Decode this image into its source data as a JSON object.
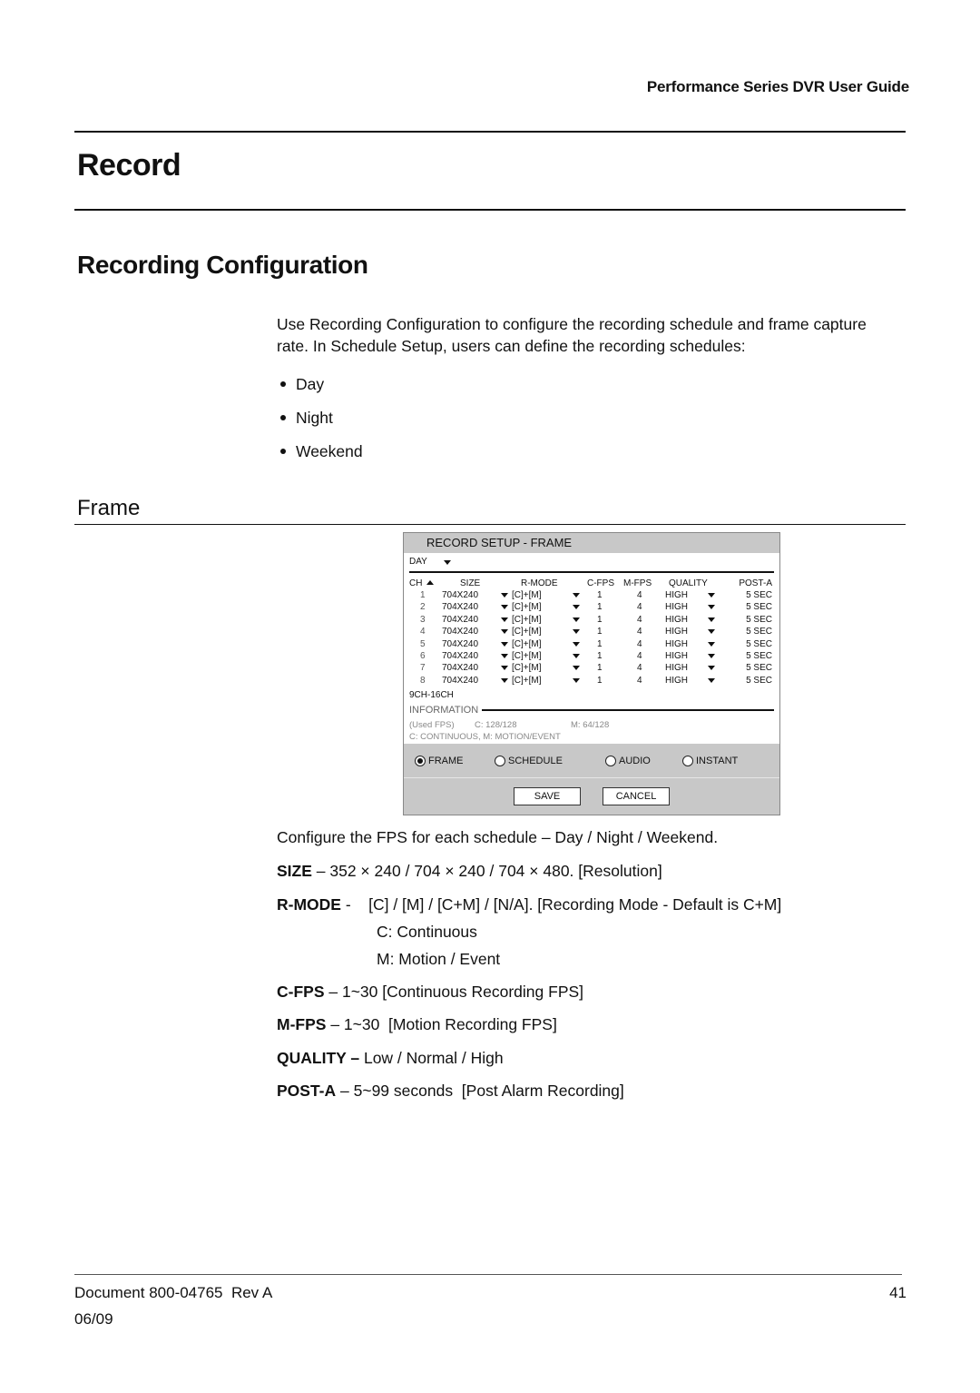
{
  "header": {
    "guide_title": "Performance Series DVR User Guide"
  },
  "chapter": {
    "title": "Record"
  },
  "section": {
    "title": "Recording Configuration",
    "intro": "Use Recording Configuration to configure the recording schedule and frame capture rate. In Schedule Setup, users can define the recording schedules:",
    "schedules": [
      "Day",
      "Night",
      "Weekend"
    ]
  },
  "subsection": {
    "title": "Frame"
  },
  "dvr_screen": {
    "title": "RECORD SETUP - FRAME",
    "schedule_select": "DAY",
    "columns": {
      "ch": "CH",
      "size": "SIZE",
      "rmode": "R-MODE",
      "cfps": "C-FPS",
      "mfps": "M-FPS",
      "quality": "QUALITY",
      "posta": "POST-A"
    },
    "rows": [
      {
        "ch": "1",
        "size": "704X240",
        "rmode": "[C]+[M]",
        "cfps": "1",
        "mfps": "4",
        "quality": "HIGH",
        "posta": "5 SEC"
      },
      {
        "ch": "2",
        "size": "704X240",
        "rmode": "[C]+[M]",
        "cfps": "1",
        "mfps": "4",
        "quality": "HIGH",
        "posta": "5 SEC"
      },
      {
        "ch": "3",
        "size": "704X240",
        "rmode": "[C]+[M]",
        "cfps": "1",
        "mfps": "4",
        "quality": "HIGH",
        "posta": "5 SEC"
      },
      {
        "ch": "4",
        "size": "704X240",
        "rmode": "[C]+[M]",
        "cfps": "1",
        "mfps": "4",
        "quality": "HIGH",
        "posta": "5 SEC"
      },
      {
        "ch": "5",
        "size": "704X240",
        "rmode": "[C]+[M]",
        "cfps": "1",
        "mfps": "4",
        "quality": "HIGH",
        "posta": "5 SEC"
      },
      {
        "ch": "6",
        "size": "704X240",
        "rmode": "[C]+[M]",
        "cfps": "1",
        "mfps": "4",
        "quality": "HIGH",
        "posta": "5 SEC"
      },
      {
        "ch": "7",
        "size": "704X240",
        "rmode": "[C]+[M]",
        "cfps": "1",
        "mfps": "4",
        "quality": "HIGH",
        "posta": "5 SEC"
      },
      {
        "ch": "8",
        "size": "704X240",
        "rmode": "[C]+[M]",
        "cfps": "1",
        "mfps": "4",
        "quality": "HIGH",
        "posta": "5 SEC"
      }
    ],
    "page_link": "9CH-16CH",
    "information": {
      "label": "INFORMATION",
      "used_fps_label": "(Used FPS)",
      "used_c": "C: 128/128",
      "used_m": "M: 64/128",
      "legend": "C: CONTINUOUS, M: MOTION/EVENT"
    },
    "tabs": [
      {
        "label": "FRAME",
        "selected": true
      },
      {
        "label": "SCHEDULE",
        "selected": false
      },
      {
        "label": "AUDIO",
        "selected": false
      },
      {
        "label": "INSTANT",
        "selected": false
      }
    ],
    "buttons": {
      "save": "SAVE",
      "cancel": "CANCEL"
    }
  },
  "descriptions": {
    "intro": "Configure the FPS for each schedule – Day / Night / Weekend.",
    "size": {
      "term": "SIZE",
      "text": " – 352 × 240 / 704 × 240 / 704 × 480. [Resolution]"
    },
    "rmode": {
      "term": "R-MODE",
      "text": " -    [C] / [M] / [C+M] / [N/A]. [Recording Mode - Default is C+M]",
      "sub1": "C: Continuous",
      "sub2": "M: Motion / Event"
    },
    "cfps": {
      "term": "C-FPS",
      "text": " – 1~30 [Continuous Recording FPS]"
    },
    "mfps": {
      "term": "M-FPS",
      "text": " – 1~30  [Motion Recording FPS]"
    },
    "quality": {
      "term": "QUALITY –",
      "text": " Low / Normal / High"
    },
    "posta": {
      "term": "POST-A",
      "text": " – 5~99 seconds  [Post Alarm Recording]"
    }
  },
  "footer": {
    "document": "Document 800-04765  Rev A",
    "date": "06/09",
    "page": "41"
  }
}
